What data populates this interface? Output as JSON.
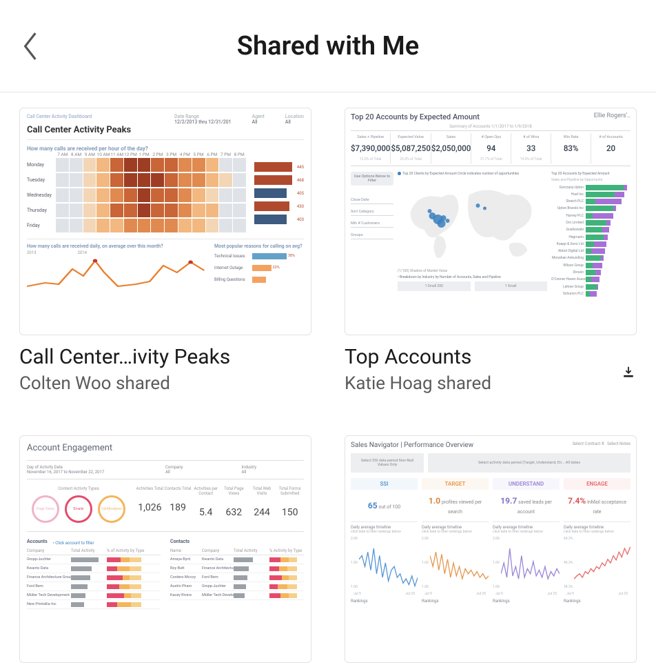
{
  "header": {
    "title": "Shared with Me",
    "back_icon": "back"
  },
  "cards": [
    {
      "title": "Call Center…ivity Peaks",
      "subtitle": "Colten Woo shared",
      "download": false,
      "thumb": {
        "kicker": "Call Center Activity Dashboard",
        "title": "Call Center Activity Peaks",
        "meta": [
          {
            "l": "Date Range",
            "v": "12/2/2013 thru 12/31/201"
          },
          {
            "l": "Agent",
            "v": "All"
          },
          {
            "l": "Location",
            "v": "All"
          }
        ],
        "question": "How many calls are received per hour of the day?",
        "hours": [
          "7 AM",
          "8 AM",
          "9 AM",
          "10 AM",
          "11 AM",
          "12 PM",
          "1 PM",
          "2 PM",
          "3 PM",
          "4 PM",
          "5 PM",
          "6 PM",
          "7 PM",
          "8 PM"
        ],
        "rows": [
          {
            "label": "Monday",
            "cells": [
              10,
              12,
              20,
              45,
              70,
              85,
              88,
              82,
              74,
              60,
              50,
              30,
              14,
              8
            ]
          },
          {
            "label": "Tuesday",
            "cells": [
              11,
              13,
              22,
              48,
              74,
              88,
              90,
              86,
              78,
              63,
              52,
              32,
              15,
              9
            ]
          },
          {
            "label": "Wednesday",
            "cells": [
              9,
              11,
              18,
              42,
              68,
              82,
              86,
              80,
              72,
              58,
              46,
              28,
              13,
              7
            ]
          },
          {
            "label": "Thursday",
            "cells": [
              10,
              12,
              20,
              44,
              70,
              84,
              88,
              82,
              74,
              60,
              48,
              30,
              14,
              8
            ]
          },
          {
            "label": "Friday",
            "cells": [
              8,
              10,
              15,
              30,
              45,
              55,
              60,
              56,
              50,
              42,
              34,
              22,
              11,
              6
            ]
          }
        ],
        "bars": [
          {
            "v": 445,
            "w": 1.0,
            "c": "#b04a2e"
          },
          {
            "v": 468,
            "w": 1.0,
            "c": "#b04a2e"
          },
          {
            "v": 405,
            "w": 0.86,
            "c": "#3d5a80"
          },
          {
            "v": 430,
            "w": 0.92,
            "c": "#b04a2e"
          },
          {
            "v": 403,
            "w": 0.86,
            "c": "#3d5a80"
          }
        ],
        "line_question": "How many calls are received daily, on average over this month?",
        "line_years": [
          "2013",
          "2014"
        ],
        "reason_question": "Most popular reasons for calling on avg?",
        "reasons": [
          {
            "label": "Technical Issues",
            "w": 1.0,
            "c": "#63a1c9",
            "v": "30%"
          },
          {
            "label": "Internet Outage",
            "w": 0.55,
            "c": "#f4a261",
            "v": "22%"
          },
          {
            "label": "Billing Questions",
            "w": 0.4,
            "c": "#f4a261",
            "v": ""
          }
        ]
      }
    },
    {
      "title": "Top Accounts",
      "subtitle": "Katie Hoag shared",
      "download": true,
      "thumb": {
        "title": "Top 20 Accounts by Expected Amount",
        "user": "Ellie Rogers'..",
        "summary_caption": "Summary of Accounts 1/1/2017 to 1/9/2018",
        "kpis": [
          {
            "l": "Sales + Pipeline",
            "v": "$7,390,000",
            "s": "12.0% of Total"
          },
          {
            "l": "Expected Value",
            "v": "$5,087,250",
            "s": "25.0% of Total"
          },
          {
            "l": "Sales",
            "v": "$2,050,000",
            "s": ""
          },
          {
            "l": "# Open Ops",
            "v": "94",
            "s": "31.7% of Total"
          },
          {
            "l": "# of Wins",
            "v": "33",
            "s": "14.0% of Total"
          },
          {
            "l": "Win Rate",
            "v": "83%",
            "s": ""
          },
          {
            "l": "# of Accounts",
            "v": "20",
            "s": ""
          }
        ],
        "filters_title": "Use Options Below to Filter",
        "filters": [
          "Close Date",
          "Sort Category",
          "Min # Customers",
          "Groups"
        ],
        "map_legend": "Top 20 Clients by Expected Amount Circle indicates number of opportunities",
        "bars_legend": "Top 20 Accounts by Expected Amount",
        "bars_sub": "Sales and Pipeline by Opportunity",
        "accounts": [
          {
            "name": "Gorczany-Upton",
            "g": 55,
            "p": 5
          },
          {
            "name": "Huel Inc",
            "g": 42,
            "p": 14
          },
          {
            "name": "Streich PLC",
            "g": 14,
            "p": 38
          },
          {
            "name": "Upton Brands Inc",
            "g": 40,
            "p": 4
          },
          {
            "name": "Harvey PLC",
            "g": 10,
            "p": 30
          },
          {
            "name": "Orn Limited",
            "g": 30,
            "p": 6
          },
          {
            "name": "Gusikowski",
            "g": 24,
            "p": 10
          },
          {
            "name": "Hegmann",
            "g": 26,
            "p": 6
          },
          {
            "name": "Koepp & Sons Ltd",
            "g": 12,
            "p": 18
          },
          {
            "name": "Abbot Digital Ltd",
            "g": 8,
            "p": 20
          },
          {
            "name": "Monahan-Ankunding",
            "g": 22,
            "p": 4
          },
          {
            "name": "Wilson Group",
            "g": 10,
            "p": 14
          },
          {
            "name": "Strosin",
            "g": 14,
            "p": 8
          },
          {
            "name": "O'Conner Haven Associates",
            "g": 8,
            "p": 12
          },
          {
            "name": "Lehner Group",
            "g": 16,
            "p": 2
          },
          {
            "name": "Schumm PLC",
            "g": 6,
            "p": 10
          }
        ],
        "footer_left": "(1/100) Shadow of Market Value",
        "footer_r1": "• Breakdown by Industry by Number of Accounts, Sales and Pipeline",
        "footer_boxes": [
          "1 Small 200",
          "1 Small"
        ]
      }
    },
    {
      "title": "",
      "subtitle": "",
      "download": false,
      "thumb": {
        "title": "Account Engagement",
        "date_label": "Day of Activity Date",
        "date_value": "November 16, 2017 to November 22, 2017",
        "company_l": "Company",
        "company_v": "All",
        "industry_l": "Industry",
        "industry_v": "All",
        "donut_caption": "Content Activity Types",
        "rings": [
          {
            "label": "Page Views",
            "c": "#f1b3c6"
          },
          {
            "label": "Emails",
            "c": "#e44b6a"
          },
          {
            "label": "Certifications",
            "c": "#f3b55d"
          }
        ],
        "kpis": [
          {
            "l": "Activities Total",
            "v": "1,026"
          },
          {
            "l": "Contacts Total",
            "v": "189"
          },
          {
            "l": "Activities per Contact",
            "v": "5.4"
          },
          {
            "l": "Total Page Views",
            "v": "632"
          },
          {
            "l": "Total Web Visits",
            "v": "244"
          },
          {
            "l": "Total Forms Submitted",
            "v": "150"
          }
        ],
        "accounts_title": "Accounts",
        "accounts_link": "• Click account to filter",
        "contacts_title": "Contacts",
        "acc_cols": [
          "Company",
          "Total Activity",
          "% of Activity by Type"
        ],
        "con_cols": [
          "Name",
          "Company",
          "Total Activity",
          "% Activity by Type"
        ],
        "accounts": [
          {
            "c": "Gropp-Juchter",
            "b": 80,
            "s": [
              40,
              25,
              35
            ]
          },
          {
            "c": "Kwanto Data",
            "b": 60,
            "s": [
              30,
              35,
              35
            ]
          },
          {
            "c": "Finance Architecture Group",
            "b": 55,
            "s": [
              45,
              20,
              35
            ]
          },
          {
            "c": "Ford Bern",
            "b": 48,
            "s": [
              35,
              30,
              35
            ]
          },
          {
            "c": "Müller Tech Development",
            "b": 42,
            "s": [
              50,
              20,
              30
            ]
          },
          {
            "c": "New Printallia Inc",
            "b": 38,
            "s": [
              30,
              40,
              30
            ]
          }
        ],
        "contacts": [
          {
            "n": "Amaya Byrd",
            "c": "Kwanto Data",
            "b": 70,
            "s": [
              40,
              30,
              30
            ]
          },
          {
            "n": "Roy Butt",
            "c": "Finance Architecture Group",
            "b": 55,
            "s": [
              35,
              30,
              35
            ]
          },
          {
            "n": "Cordero Mccoy",
            "c": "Ford Bern",
            "b": 50,
            "s": [
              45,
              25,
              30
            ]
          },
          {
            "n": "Austin Pham",
            "c": "Gropp-Juchter",
            "b": 44,
            "s": [
              30,
              35,
              35
            ]
          },
          {
            "n": "Kacey Rivers",
            "c": "Müller Tech Development",
            "b": 40,
            "s": [
              40,
              30,
              30
            ]
          }
        ]
      }
    },
    {
      "title": "",
      "subtitle": "",
      "download": false,
      "thumb": {
        "title": "Sales Navigator | Performance Overview",
        "head_r": [
          "Select Contract #",
          "Select Notes"
        ],
        "filter1": "Select SSI data period Non-Null Values Only",
        "filter2": "Select activity data period (Target, Understand, En...\nAll dates",
        "cols": [
          {
            "tag": "SSI",
            "tagc": "#5596d4",
            "kpi_num": "65",
            "kpi_suf": " out of 100",
            "kpi_c": "#4b86c6",
            "sub": "",
            "line_c": "#5596d4"
          },
          {
            "tag": "TARGET",
            "tagc": "#e3984e",
            "kpi_num": "1.0",
            "kpi_suf": " profiles viewed per search",
            "kpi_c": "#d9863b",
            "line_c": "#e3984e"
          },
          {
            "tag": "UNDERSTAND",
            "tagc": "#9a86d6",
            "kpi_num": "19.7",
            "kpi_suf": " saved leads per account",
            "kpi_c": "#8671c9",
            "line_c": "#9a86d6"
          },
          {
            "tag": "ENGAGE",
            "tagc": "#e86a6a",
            "kpi_num": "7.4%",
            "kpi_suf": " InMail acceptance rate",
            "kpi_c": "#da5757",
            "line_c": "#e86a6a"
          }
        ],
        "spark_title": "Daily average timeline",
        "spark_sub": "click date to filter rankings below",
        "ylabels": [
          "2.00",
          "1.00",
          "1.00"
        ],
        "xlabels": [
          "Jul 9",
          "Jul 25"
        ],
        "sparks": [
          "0,35 5,30 10,45 15,25 20,50 25,20 30,55 35,30 40,60 45,40 50,65 55,50 60,45 65,60 70,55 75,68 80,62 85,70 90,58 95,72 100,60",
          "0,30 5,45 10,25 15,50 20,28 25,55 30,35 35,60 40,40 45,58 50,45 55,62 60,48 65,55 70,50 75,58 80,52 85,60 90,55 95,62 100,58",
          "0,55 5,40 10,60 15,20 20,58 25,45 30,62 35,30 40,60 45,48 50,55 55,38 60,58 65,50 70,60 75,45 80,62 85,52 90,58 95,48 100,55",
          "0,62 5,58 10,55 15,60 20,52 25,55 30,48 35,52 40,45 45,48 50,40 55,44 60,35 65,40 70,30 75,36 80,25 85,32 90,20 95,28 100,18"
        ],
        "ylabels_grid": [
          "64.3%",
          "45.3%",
          "34.3%"
        ],
        "rank_label": "Rankings"
      }
    }
  ]
}
